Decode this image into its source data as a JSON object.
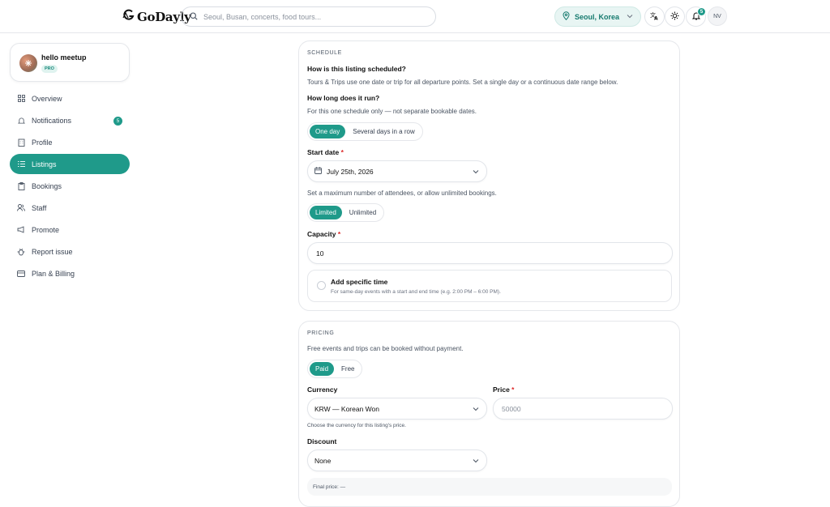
{
  "header": {
    "brand": "GoDayly",
    "brand_sub": "",
    "search_placeholder": "Seoul, Busan, concerts, food tours...",
    "location": "Seoul, Korea",
    "notification_count": "5",
    "avatar_initials": "NV"
  },
  "sidebar": {
    "org_name": "hello meetup",
    "org_plan": "PRO",
    "items": [
      {
        "label": "Overview",
        "icon": "grid-icon"
      },
      {
        "label": "Notifications",
        "icon": "bell-icon",
        "badge": "5"
      },
      {
        "label": "Profile",
        "icon": "building-icon"
      },
      {
        "label": "Listings",
        "icon": "list-icon",
        "active": true
      },
      {
        "label": "Bookings",
        "icon": "clipboard-icon"
      },
      {
        "label": "Staff",
        "icon": "users-icon"
      },
      {
        "label": "Promote",
        "icon": "megaphone-icon"
      },
      {
        "label": "Report issue",
        "icon": "bug-icon"
      },
      {
        "label": "Plan & Billing",
        "icon": "card-icon"
      }
    ]
  },
  "schedule": {
    "section_title": "SCHEDULE",
    "q1": "How is this listing scheduled?",
    "q1_help": "Tours & Trips use one date or trip for all departure points. Set a single day or a continuous date range below.",
    "q2": "How long does it run?",
    "q2_help": "For this one schedule only — not separate bookable dates.",
    "duration_options": [
      "One day",
      "Several days in a row"
    ],
    "start_date_label": "Start date",
    "start_date_value": "July 25th, 2026",
    "attendees_help": "Set a maximum number of attendees, or allow unlimited bookings.",
    "capacity_options": [
      "Limited",
      "Unlimited"
    ],
    "capacity_label": "Capacity",
    "capacity_value": "10",
    "specific_time_title": "Add specific time",
    "specific_time_help": "For same-day events with a start and end time (e.g. 2:00 PM – 6:00 PM)."
  },
  "pricing": {
    "section_title": "PRICING",
    "help": "Free events and trips can be booked without payment.",
    "options": [
      "Paid",
      "Free"
    ],
    "currency_label": "Currency",
    "currency_value": "KRW — Korean Won",
    "currency_help": "Choose the currency for this listing's price.",
    "price_label": "Price",
    "price_placeholder": "50000",
    "discount_label": "Discount",
    "discount_value": "None",
    "final_price": "Final price: —"
  },
  "colors": {
    "accent": "#1f9a8a",
    "required": "#dc2626"
  }
}
